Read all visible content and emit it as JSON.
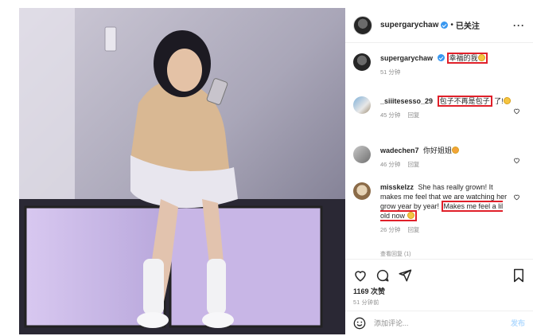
{
  "header": {
    "username": "supergarychaw",
    "separator": "•",
    "follow_status": "已关注",
    "more": "···"
  },
  "comments": [
    {
      "user": "supergarychaw",
      "text": "幸福的我",
      "time": "51 分钟",
      "reply": ""
    },
    {
      "user": "_siiitesesso_29",
      "text": "包子不再是包子",
      "text_cont": "了!",
      "time": "45 分钟",
      "reply": "回复"
    },
    {
      "user": "wadechen7",
      "text": "你好姐姐",
      "time": "46 分钟",
      "reply": "回复"
    },
    {
      "user": "misskelzz",
      "text": "She has really grown! It makes me feel that we are watching her grow year by year!",
      "text_hl": "Makes me feel a lil old now",
      "time": "26 分钟",
      "reply": "回复"
    }
  ],
  "view_replies": "查看回复 (1)",
  "actions": {
    "likes": "1169 次赞",
    "time": "51 分钟前"
  },
  "add_comment": {
    "placeholder": "添加评论...",
    "post_label": "发布"
  }
}
